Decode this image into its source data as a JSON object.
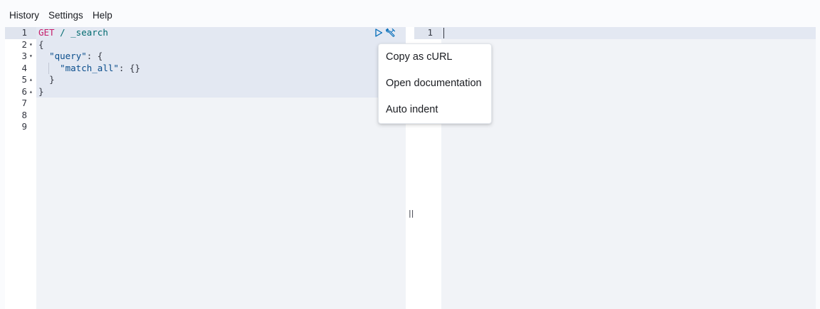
{
  "menubar": {
    "items": [
      "History",
      "Settings",
      "Help"
    ]
  },
  "editor": {
    "lines": [
      {
        "num": "1",
        "fold": ""
      },
      {
        "num": "2",
        "fold": "▾"
      },
      {
        "num": "3",
        "fold": "▾"
      },
      {
        "num": "4",
        "fold": ""
      },
      {
        "num": "5",
        "fold": "▴"
      },
      {
        "num": "6",
        "fold": "▴"
      },
      {
        "num": "7",
        "fold": ""
      },
      {
        "num": "8",
        "fold": ""
      },
      {
        "num": "9",
        "fold": ""
      }
    ],
    "code": {
      "method": "GET",
      "url": "/ _search",
      "open_brace": "{",
      "query_key": "\"query\"",
      "query_rest": ": {",
      "match_all_key": "\"match_all\"",
      "match_all_rest": ": {}",
      "close_inner": "}",
      "close_outer": "}"
    },
    "actions": {
      "play_icon": "play-icon",
      "wrench_icon": "wrench-icon"
    }
  },
  "resizer": {
    "grip": "||"
  },
  "output": {
    "line_number": "1"
  },
  "context_menu": {
    "items": [
      "Copy as cURL",
      "Open documentation",
      "Auto indent"
    ]
  },
  "colors": {
    "method": "#c61e6b",
    "url": "#006a6f",
    "key": "#0a4d8c",
    "action_icon": "#006bb8"
  }
}
